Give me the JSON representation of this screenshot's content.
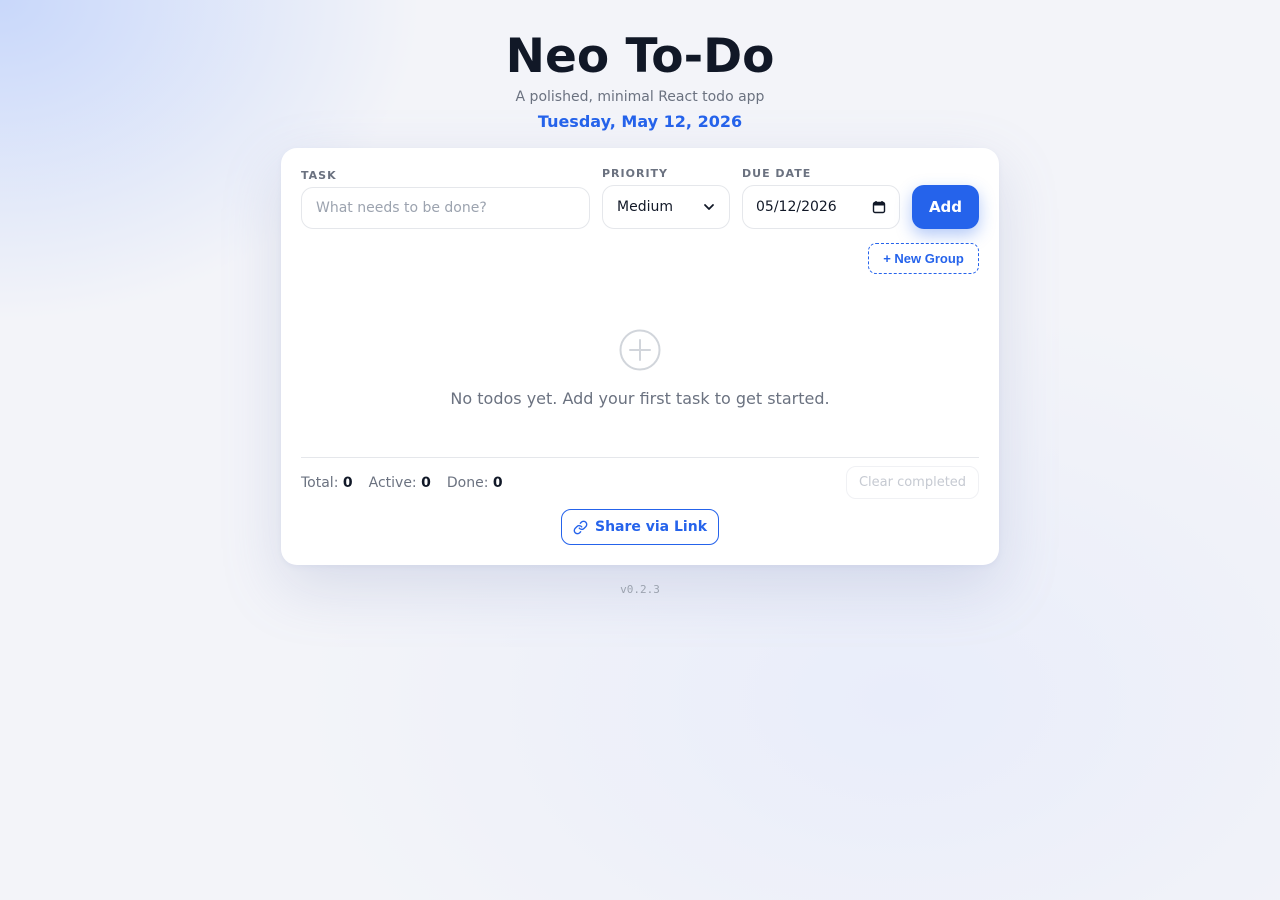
{
  "header": {
    "title": "Neo To-Do",
    "subtitle": "A polished, minimal React todo app",
    "date": "Tuesday, May 12, 2026"
  },
  "form": {
    "task_label": "TASK",
    "task_placeholder": "What needs to be done?",
    "task_value": "",
    "priority_label": "PRIORITY",
    "priority_value": "Medium",
    "due_date_label": "DUE DATE",
    "due_date_value": "05/12/2026",
    "add_label": "Add",
    "new_group_label": "+ New Group"
  },
  "empty_state": {
    "icon": "plus-circle-icon",
    "message": "No todos yet. Add your first task to get started."
  },
  "stats": {
    "total_label": "Total:",
    "total_value": "0",
    "active_label": "Active:",
    "active_value": "0",
    "done_label": "Done:",
    "done_value": "0"
  },
  "actions": {
    "clear_completed_label": "Clear completed",
    "share_label": "Share via Link",
    "share_icon": "link-icon"
  },
  "footer": {
    "version": "v0.2.3"
  },
  "colors": {
    "accent": "#2563eb",
    "title": "#111827",
    "muted": "#6b7280"
  }
}
